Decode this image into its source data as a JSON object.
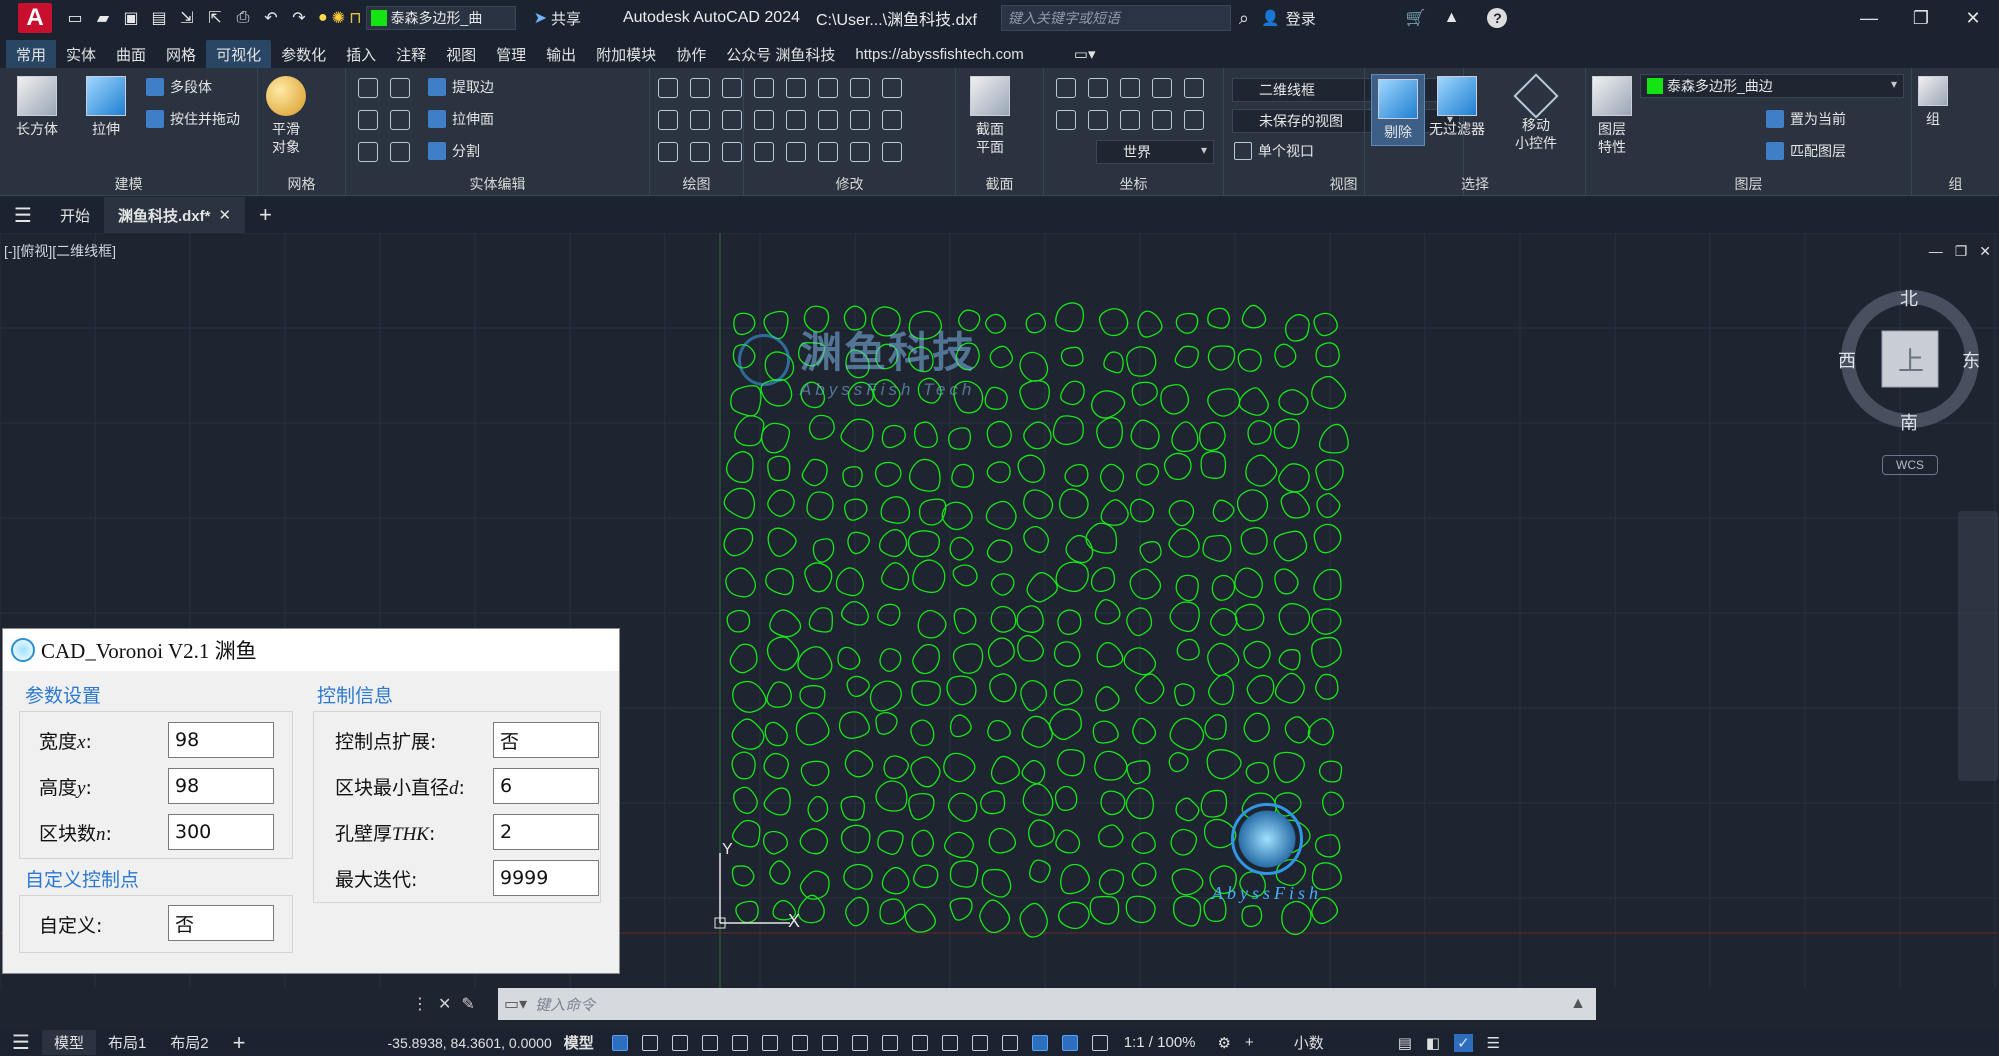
{
  "app": {
    "logo_letter": "A",
    "title": "Autodesk AutoCAD 2024",
    "file_path": "C:\\User...\\渊鱼科技.dxf",
    "search_placeholder": "键入关键字或短语",
    "login_label": "登录",
    "share_label": "共享",
    "layer_name_top": "泰森多边形_曲",
    "window_controls": [
      "minimize-icon",
      "restore-icon",
      "close-icon"
    ]
  },
  "ribbon_tabs": [
    "常用",
    "实体",
    "曲面",
    "网格",
    "可视化",
    "参数化",
    "插入",
    "注释",
    "视图",
    "管理",
    "输出",
    "附加模块",
    "协作",
    "公众号 渊鱼科技",
    "https://abyssfishtech.com"
  ],
  "active_ribbon_tab": "可视化",
  "ribbon": {
    "modeling": {
      "title": "建模",
      "box": "长方体",
      "extrude": "拉伸",
      "polysolid": "多段体",
      "presspull": "按住并拖动"
    },
    "mesh": {
      "title": "网格",
      "smooth_line1": "平滑",
      "smooth_line2": "对象"
    },
    "solid_edit": {
      "title": "实体编辑",
      "extract_edges": "提取边",
      "extrude_faces": "拉伸面",
      "separate": "分割"
    },
    "draw": {
      "title": "绘图"
    },
    "modify": {
      "title": "修改"
    },
    "section": {
      "title": "截面",
      "plane_line1": "截面",
      "plane_line2": "平面"
    },
    "coordinates": {
      "title": "坐标",
      "ucs_combo": "世界"
    },
    "view": {
      "title": "视图",
      "visual_style": "二维线框",
      "saved_view": "未保存的视图",
      "viewport": "单个视口"
    },
    "selection": {
      "title": "选择",
      "cull": "剔除",
      "no_filter": "无过滤器",
      "gizmo_line1": "移动",
      "gizmo_line2": "小控件"
    },
    "layers": {
      "title": "图层",
      "props_line1": "图层",
      "props_line2": "特性",
      "layer_combo": "泰森多边形_曲边",
      "make_current": "置为当前",
      "match_layer": "匹配图层"
    },
    "groups": {
      "title": "组",
      "group": "组"
    }
  },
  "doc_tabs": [
    {
      "label": "开始"
    },
    {
      "label": "渊鱼科技.dxf*"
    }
  ],
  "viewport": {
    "label": "[-][俯视][二维线框]",
    "compass": {
      "north": "北",
      "south": "南",
      "east": "东",
      "west": "西",
      "top": "上"
    },
    "wcs": "WCS",
    "watermark_cn": "渊鱼科技",
    "watermark_en": "AbyssFish Tech",
    "logo_text": "AbyssFish",
    "ucs_y": "Y",
    "ucs_x": "X"
  },
  "dialog": {
    "title": "CAD_Voronoi V2.1 渊鱼",
    "params_title": "参数设置",
    "control_title": "控制信息",
    "custom_title": "自定义控制点",
    "width_label": "宽度",
    "width_var": "x",
    "width_value": "98",
    "height_label": "高度",
    "height_var": "y",
    "height_value": "98",
    "blocks_label": "区块数",
    "blocks_var": "n",
    "blocks_value": "300",
    "expand_label": "控制点扩展:",
    "expand_value": "否",
    "min_dia_label": "区块最小直径",
    "min_dia_var": "d",
    "min_dia_value": "6",
    "wall_label": "孔壁厚",
    "wall_var": "THK",
    "wall_value": "2",
    "max_iter_label": "最大迭代:",
    "max_iter_value": "9999",
    "custom_label": "自定义:",
    "custom_value": "否"
  },
  "command_line": {
    "placeholder": "键入命令"
  },
  "status_bar": {
    "tabs": [
      "模型",
      "布局1",
      "布局2"
    ],
    "coords": "-35.8938, 84.3601, 0.0000",
    "model_label": "模型",
    "scale": "1:1 / 100%",
    "units": "小数"
  },
  "colors": {
    "accent": "#2a4665",
    "pattern": "#19e619",
    "dialog_blue": "#2a78d0"
  }
}
